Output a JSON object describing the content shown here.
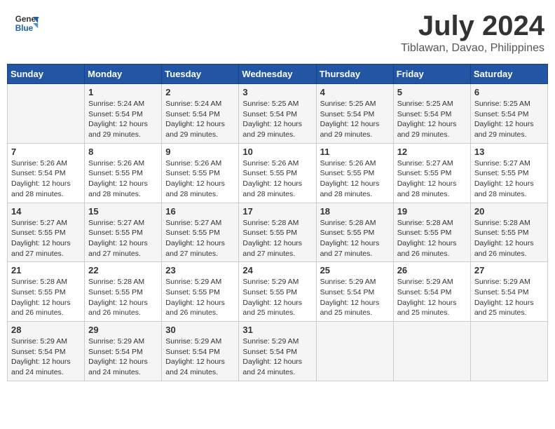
{
  "header": {
    "logo_line1": "General",
    "logo_line2": "Blue",
    "title": "July 2024",
    "subtitle": "Tiblawan, Davao, Philippines"
  },
  "days_of_week": [
    "Sunday",
    "Monday",
    "Tuesday",
    "Wednesday",
    "Thursday",
    "Friday",
    "Saturday"
  ],
  "weeks": [
    [
      {
        "day": "",
        "info": ""
      },
      {
        "day": "1",
        "info": "Sunrise: 5:24 AM\nSunset: 5:54 PM\nDaylight: 12 hours\nand 29 minutes."
      },
      {
        "day": "2",
        "info": "Sunrise: 5:24 AM\nSunset: 5:54 PM\nDaylight: 12 hours\nand 29 minutes."
      },
      {
        "day": "3",
        "info": "Sunrise: 5:25 AM\nSunset: 5:54 PM\nDaylight: 12 hours\nand 29 minutes."
      },
      {
        "day": "4",
        "info": "Sunrise: 5:25 AM\nSunset: 5:54 PM\nDaylight: 12 hours\nand 29 minutes."
      },
      {
        "day": "5",
        "info": "Sunrise: 5:25 AM\nSunset: 5:54 PM\nDaylight: 12 hours\nand 29 minutes."
      },
      {
        "day": "6",
        "info": "Sunrise: 5:25 AM\nSunset: 5:54 PM\nDaylight: 12 hours\nand 29 minutes."
      }
    ],
    [
      {
        "day": "7",
        "info": "Sunrise: 5:26 AM\nSunset: 5:54 PM\nDaylight: 12 hours\nand 28 minutes."
      },
      {
        "day": "8",
        "info": "Sunrise: 5:26 AM\nSunset: 5:55 PM\nDaylight: 12 hours\nand 28 minutes."
      },
      {
        "day": "9",
        "info": "Sunrise: 5:26 AM\nSunset: 5:55 PM\nDaylight: 12 hours\nand 28 minutes."
      },
      {
        "day": "10",
        "info": "Sunrise: 5:26 AM\nSunset: 5:55 PM\nDaylight: 12 hours\nand 28 minutes."
      },
      {
        "day": "11",
        "info": "Sunrise: 5:26 AM\nSunset: 5:55 PM\nDaylight: 12 hours\nand 28 minutes."
      },
      {
        "day": "12",
        "info": "Sunrise: 5:27 AM\nSunset: 5:55 PM\nDaylight: 12 hours\nand 28 minutes."
      },
      {
        "day": "13",
        "info": "Sunrise: 5:27 AM\nSunset: 5:55 PM\nDaylight: 12 hours\nand 28 minutes."
      }
    ],
    [
      {
        "day": "14",
        "info": "Sunrise: 5:27 AM\nSunset: 5:55 PM\nDaylight: 12 hours\nand 27 minutes."
      },
      {
        "day": "15",
        "info": "Sunrise: 5:27 AM\nSunset: 5:55 PM\nDaylight: 12 hours\nand 27 minutes."
      },
      {
        "day": "16",
        "info": "Sunrise: 5:27 AM\nSunset: 5:55 PM\nDaylight: 12 hours\nand 27 minutes."
      },
      {
        "day": "17",
        "info": "Sunrise: 5:28 AM\nSunset: 5:55 PM\nDaylight: 12 hours\nand 27 minutes."
      },
      {
        "day": "18",
        "info": "Sunrise: 5:28 AM\nSunset: 5:55 PM\nDaylight: 12 hours\nand 27 minutes."
      },
      {
        "day": "19",
        "info": "Sunrise: 5:28 AM\nSunset: 5:55 PM\nDaylight: 12 hours\nand 26 minutes."
      },
      {
        "day": "20",
        "info": "Sunrise: 5:28 AM\nSunset: 5:55 PM\nDaylight: 12 hours\nand 26 minutes."
      }
    ],
    [
      {
        "day": "21",
        "info": "Sunrise: 5:28 AM\nSunset: 5:55 PM\nDaylight: 12 hours\nand 26 minutes."
      },
      {
        "day": "22",
        "info": "Sunrise: 5:28 AM\nSunset: 5:55 PM\nDaylight: 12 hours\nand 26 minutes."
      },
      {
        "day": "23",
        "info": "Sunrise: 5:29 AM\nSunset: 5:55 PM\nDaylight: 12 hours\nand 26 minutes."
      },
      {
        "day": "24",
        "info": "Sunrise: 5:29 AM\nSunset: 5:55 PM\nDaylight: 12 hours\nand 25 minutes."
      },
      {
        "day": "25",
        "info": "Sunrise: 5:29 AM\nSunset: 5:54 PM\nDaylight: 12 hours\nand 25 minutes."
      },
      {
        "day": "26",
        "info": "Sunrise: 5:29 AM\nSunset: 5:54 PM\nDaylight: 12 hours\nand 25 minutes."
      },
      {
        "day": "27",
        "info": "Sunrise: 5:29 AM\nSunset: 5:54 PM\nDaylight: 12 hours\nand 25 minutes."
      }
    ],
    [
      {
        "day": "28",
        "info": "Sunrise: 5:29 AM\nSunset: 5:54 PM\nDaylight: 12 hours\nand 24 minutes."
      },
      {
        "day": "29",
        "info": "Sunrise: 5:29 AM\nSunset: 5:54 PM\nDaylight: 12 hours\nand 24 minutes."
      },
      {
        "day": "30",
        "info": "Sunrise: 5:29 AM\nSunset: 5:54 PM\nDaylight: 12 hours\nand 24 minutes."
      },
      {
        "day": "31",
        "info": "Sunrise: 5:29 AM\nSunset: 5:54 PM\nDaylight: 12 hours\nand 24 minutes."
      },
      {
        "day": "",
        "info": ""
      },
      {
        "day": "",
        "info": ""
      },
      {
        "day": "",
        "info": ""
      }
    ]
  ]
}
